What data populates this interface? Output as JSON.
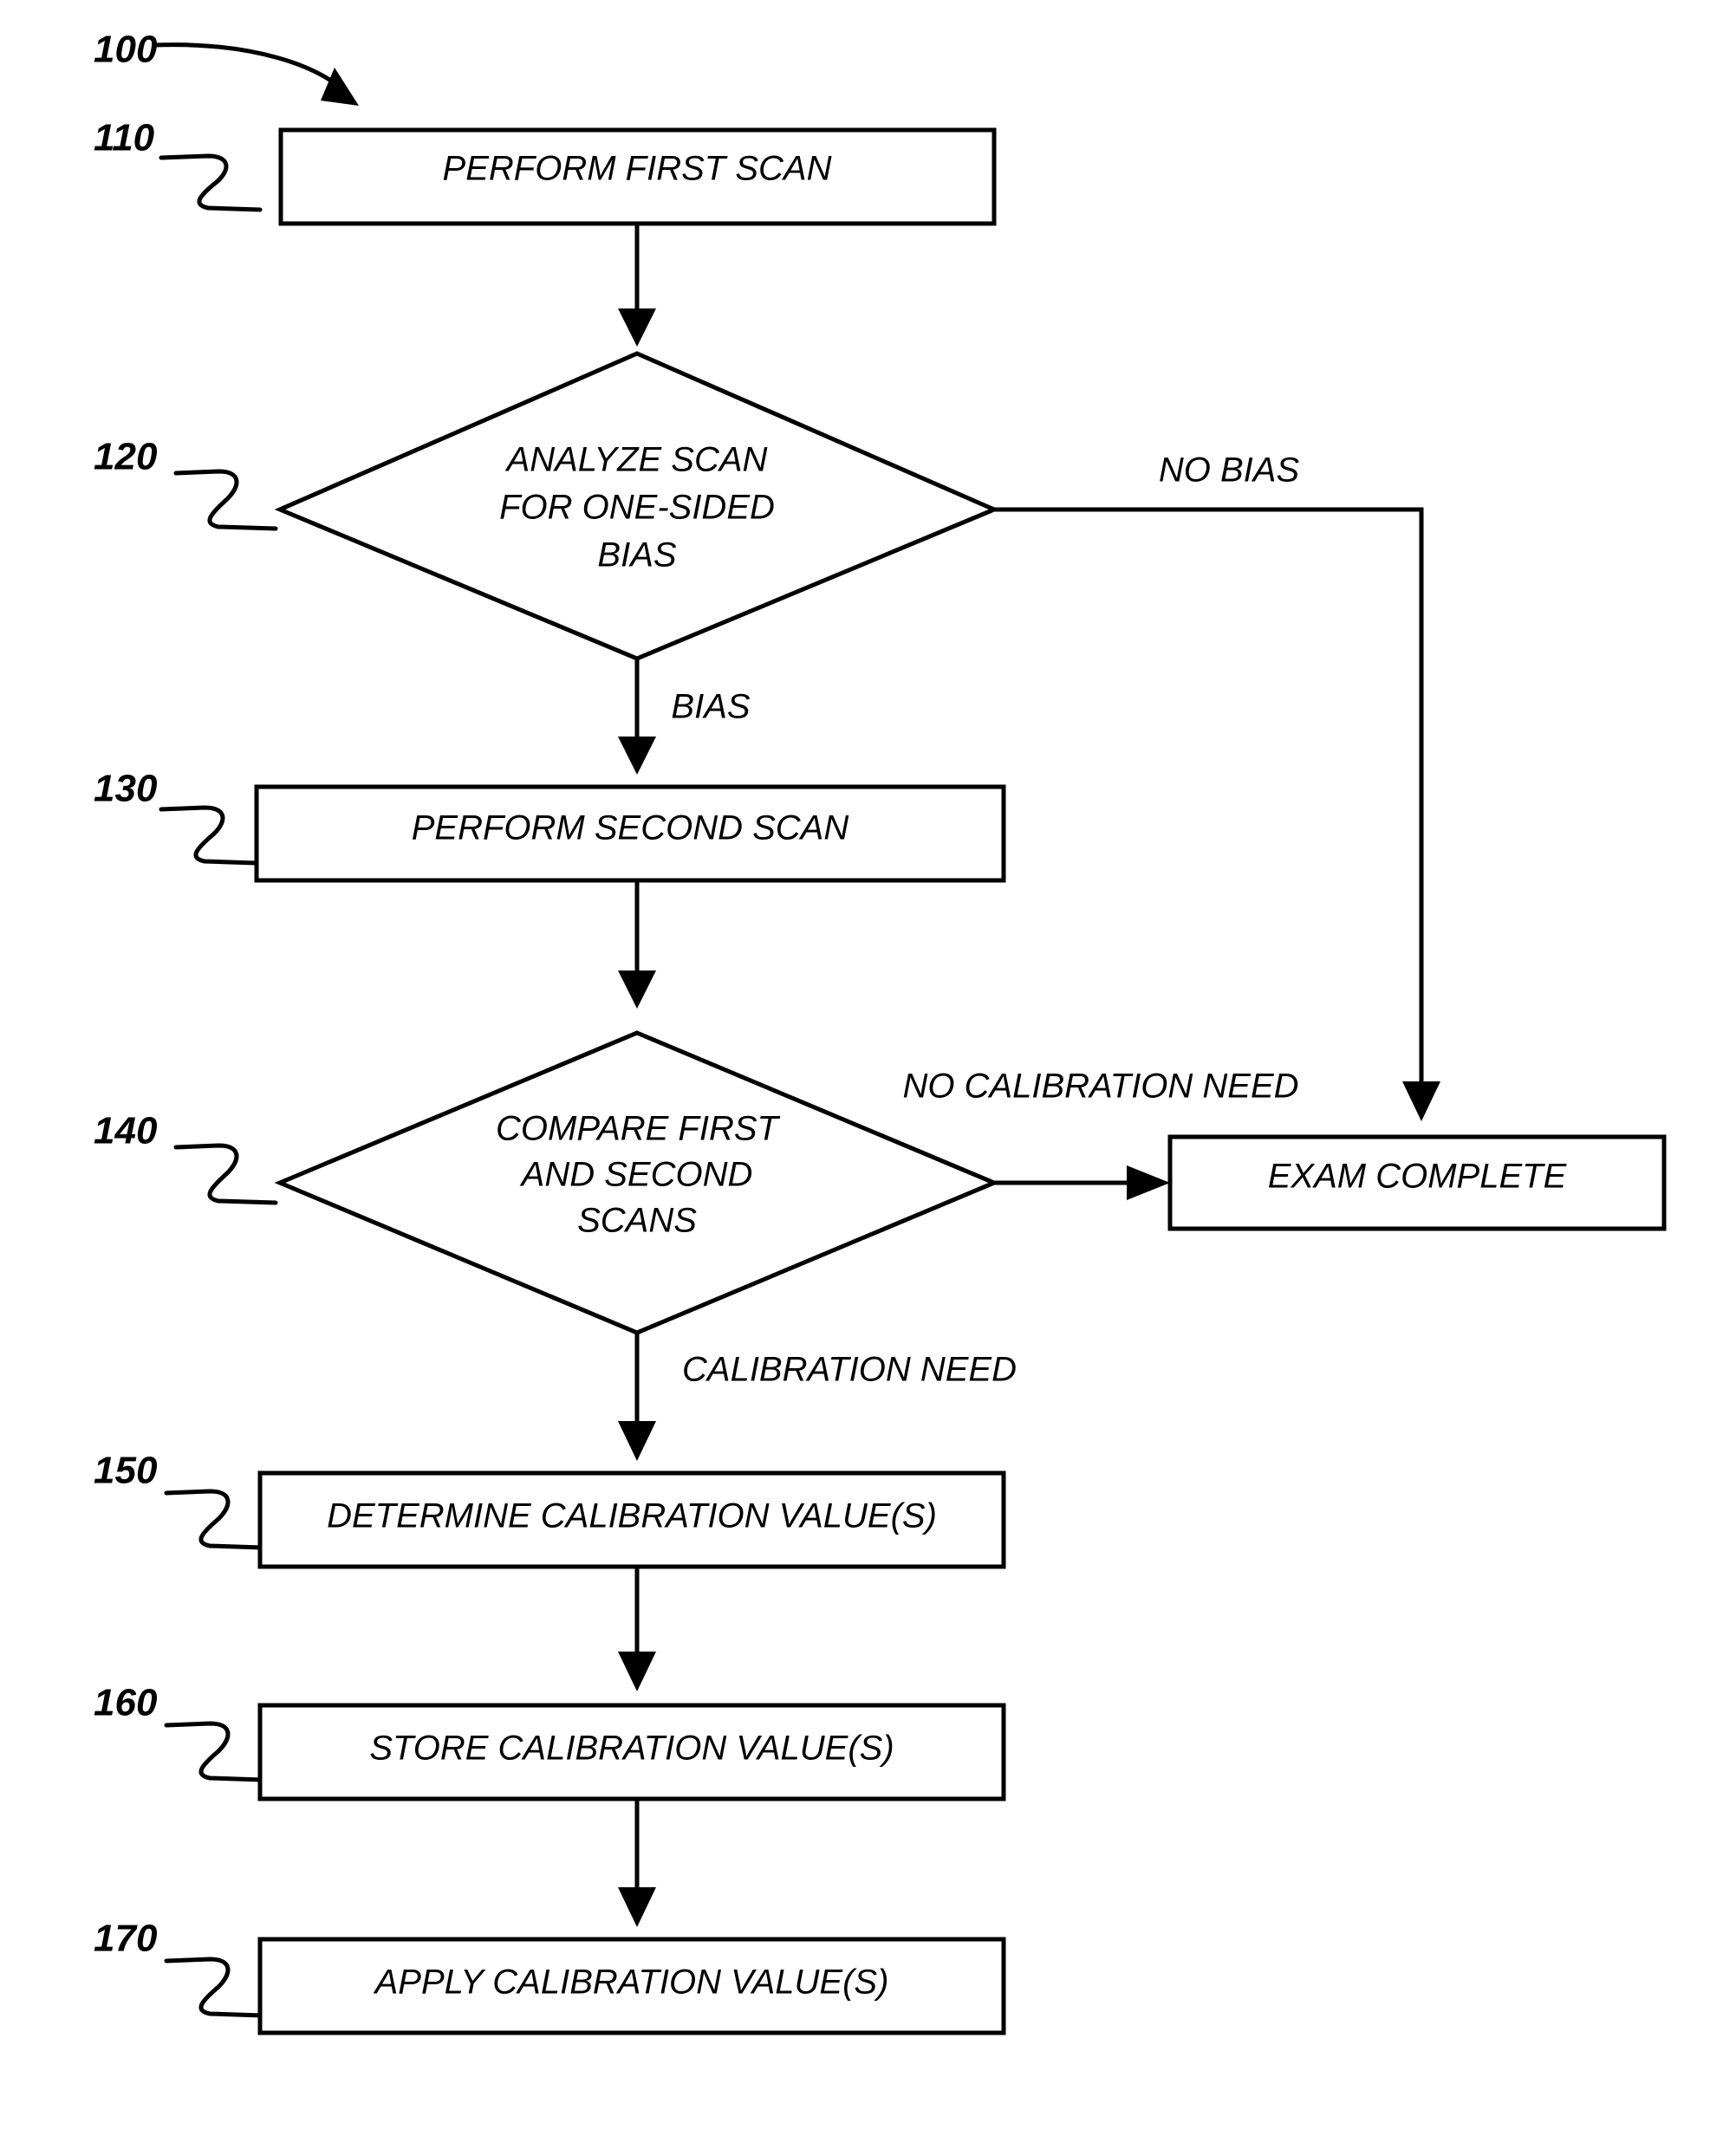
{
  "figure": {
    "type": "patent-flowchart",
    "process_ref": "100",
    "background_color": "#ffffff",
    "line_color": "#000000"
  },
  "nodes": [
    {
      "ref": "110",
      "shape": "rectangle",
      "label": "PERFORM FIRST SCAN"
    },
    {
      "ref": "120",
      "shape": "diamond",
      "label_lines": [
        "ANALYZE SCAN",
        "FOR ONE-SIDED",
        "BIAS"
      ]
    },
    {
      "ref": "130",
      "shape": "rectangle",
      "label": "PERFORM SECOND SCAN"
    },
    {
      "ref": "140",
      "shape": "diamond",
      "label_lines": [
        "COMPARE FIRST",
        "AND SECOND",
        "SCANS"
      ]
    },
    {
      "ref": "150",
      "shape": "rectangle",
      "label": "DETERMINE CALIBRATION VALUE(S)"
    },
    {
      "ref": "160",
      "shape": "rectangle",
      "label": "STORE CALIBRATION VALUE(S)"
    },
    {
      "ref": "170",
      "shape": "rectangle",
      "label": "APPLY CALIBRATION VALUE(S)"
    },
    {
      "ref": "",
      "shape": "rectangle",
      "label": "EXAM COMPLETE"
    }
  ],
  "edge_labels": {
    "no_bias": "NO BIAS",
    "bias": "BIAS",
    "no_calibration_need": "NO CALIBRATION NEED",
    "calibration_need": "CALIBRATION NEED"
  },
  "ref_numerals": {
    "process": "100",
    "first_scan": "110",
    "analyze": "120",
    "second_scan": "130",
    "compare": "140",
    "determine": "150",
    "store": "160",
    "apply": "170"
  }
}
